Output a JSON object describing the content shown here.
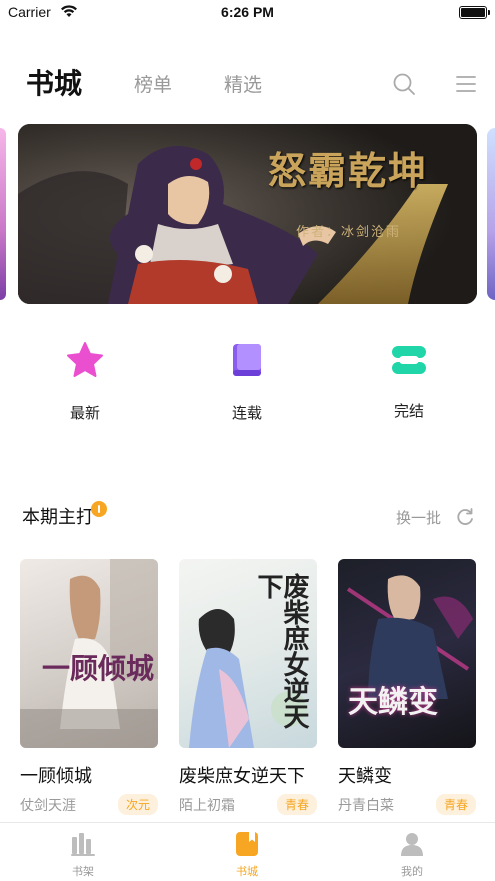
{
  "status_bar": {
    "carrier": "Carrier",
    "time": "6:26 PM"
  },
  "header": {
    "tabs": [
      {
        "label": "书城",
        "active": true
      },
      {
        "label": "榜单",
        "active": false
      },
      {
        "label": "精选",
        "active": false
      }
    ],
    "icons": [
      "search-icon",
      "menu-icon"
    ]
  },
  "banner": {
    "title": "怒霸乾坤",
    "author": "作者：冰剑沧雨"
  },
  "categories": [
    {
      "label": "最新",
      "icon": "star-icon",
      "color": "#ea4fd0"
    },
    {
      "label": "连载",
      "icon": "book-icon",
      "color": "#8a5cf0"
    },
    {
      "label": "完结",
      "icon": "stack-icon",
      "color": "#20d6a8"
    }
  ],
  "section": {
    "title": "本期主打",
    "refresh_label": "换一批"
  },
  "books": [
    {
      "title": "一顾倾城",
      "author": "仗剑天涯",
      "tag": "次元",
      "cover_text": "一顾倾城"
    },
    {
      "title": "废柴庶女逆天下",
      "author": "陌上初霜",
      "tag": "青春",
      "cover_text": "废柴庶女逆天下"
    },
    {
      "title": "天鳞变",
      "author": "丹青白菜",
      "tag": "青春",
      "cover_text": "天鳞变"
    }
  ],
  "tabbar": {
    "items": [
      {
        "label": "书架",
        "icon": "bookshelf-icon",
        "active": false
      },
      {
        "label": "书城",
        "icon": "bookstore-icon",
        "active": true
      },
      {
        "label": "我的",
        "icon": "profile-icon",
        "active": false
      }
    ]
  },
  "colors": {
    "accent": "#f6a623",
    "inactive": "#999999",
    "text": "#111111"
  }
}
